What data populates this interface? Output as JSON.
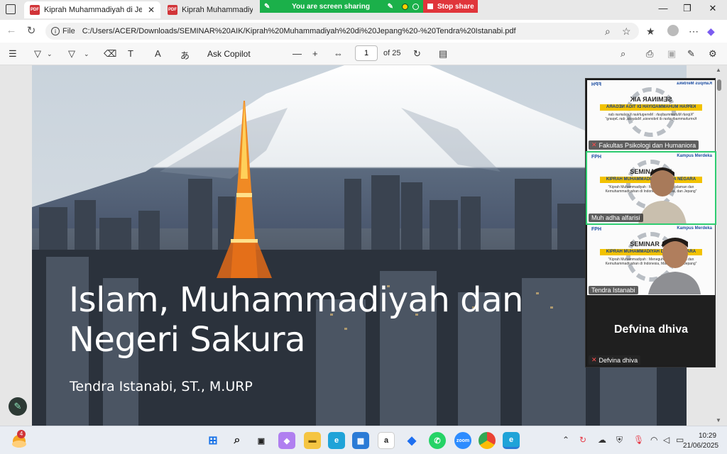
{
  "browser": {
    "tabs": [
      {
        "label": "Kiprah Muhammadiyah di Jepang",
        "active": true
      },
      {
        "label": "Kiprah Muhammadiyah di Je",
        "active": false
      }
    ],
    "share_banner": {
      "label": "You are screen sharing",
      "stop_label": "Stop share"
    },
    "address": {
      "scheme_label": "File",
      "url": "C:/Users/ACER/Downloads/SEMINAR%20AIK/Kiprah%20Muhammadiyah%20di%20Jepang%20-%20Tendra%20Istanabi.pdf"
    }
  },
  "pdf_toolbar": {
    "ask_label": "Ask Copilot",
    "page_current": "1",
    "page_total": "of 25"
  },
  "slide": {
    "title_line1": "Islam, Muhammadiyah dan",
    "title_line2": "Negeri Sakura",
    "author": "Tendra Istanabi, ST., M.URP"
  },
  "meeting": {
    "participants": [
      {
        "name": "Fakultas Psikologi dan Humaniora",
        "muted": true
      },
      {
        "name": "Muh adha alfarisi",
        "muted": false,
        "speaking": true
      },
      {
        "name": "Tendra Istanabi",
        "muted": false
      },
      {
        "name": "Defvina dhiva",
        "muted": true
      }
    ],
    "banner": {
      "logo_left": "FPH",
      "logo_right": "Kampus Merdeka",
      "heading": "SEMINAR AIK",
      "ribbon": "KIPRAH MUHAMMADIYAH DI TIGA NEGARA",
      "subtitle": "\"Kiprah Muhammadiyah : Meneguhkan Keislaman dan Kemuhammadiyahan di Indonesia, Malaysia, dan Jepang\""
    }
  },
  "taskbar": {
    "notification_count": "4",
    "time": "10:29",
    "date": "21/06/2025"
  }
}
